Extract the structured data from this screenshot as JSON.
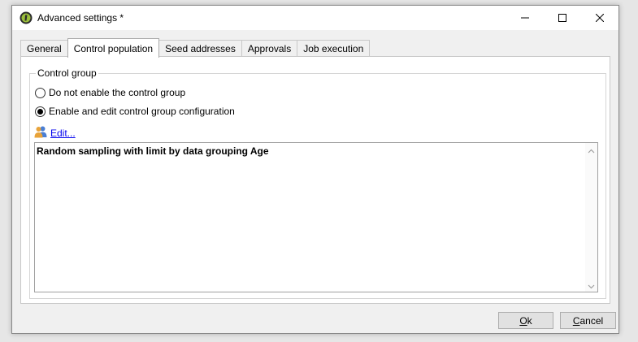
{
  "window": {
    "title": "Advanced settings *"
  },
  "tabs": [
    {
      "label": "General",
      "active": false
    },
    {
      "label": "Control population",
      "active": true
    },
    {
      "label": "Seed addresses",
      "active": false
    },
    {
      "label": "Approvals",
      "active": false
    },
    {
      "label": "Job execution",
      "active": false
    }
  ],
  "control_group": {
    "legend": "Control group",
    "option_disable": "Do not enable the control group",
    "option_enable": "Enable and edit control group configuration",
    "selected": "enable",
    "edit_link": "Edit...",
    "description": "Random sampling with limit by data grouping Age"
  },
  "footer": {
    "ok_label_first": "O",
    "ok_label_rest": "k",
    "cancel_label_first": "C",
    "cancel_label_rest": "ancel"
  },
  "icons": {
    "app": "app-logo-icon",
    "edit": "users-icon",
    "minimize": "minimize-icon",
    "maximize": "maximize-icon",
    "close": "close-icon"
  }
}
